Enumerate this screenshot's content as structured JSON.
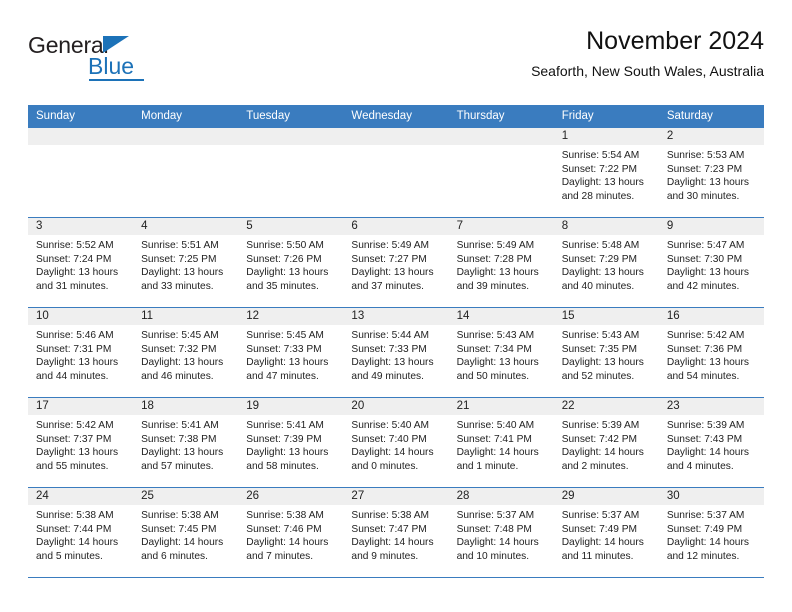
{
  "brand": {
    "name_top": "General",
    "name_bottom": "Blue",
    "accent_color": "#1c72b8"
  },
  "header": {
    "title": "November 2024",
    "subtitle": "Seaforth, New South Wales, Australia"
  },
  "theme": {
    "header_bar_color": "#3a7cbf",
    "daynum_band_color": "#efefef",
    "row_border_color": "#3a7cbf"
  },
  "calendar": {
    "weekday_headers": [
      "Sunday",
      "Monday",
      "Tuesday",
      "Wednesday",
      "Thursday",
      "Friday",
      "Saturday"
    ],
    "weeks": [
      [
        {
          "day": "",
          "empty": true
        },
        {
          "day": "",
          "empty": true
        },
        {
          "day": "",
          "empty": true
        },
        {
          "day": "",
          "empty": true
        },
        {
          "day": "",
          "empty": true
        },
        {
          "day": "1",
          "sunrise": "Sunrise: 5:54 AM",
          "sunset": "Sunset: 7:22 PM",
          "daylight": "Daylight: 13 hours and 28 minutes."
        },
        {
          "day": "2",
          "sunrise": "Sunrise: 5:53 AM",
          "sunset": "Sunset: 7:23 PM",
          "daylight": "Daylight: 13 hours and 30 minutes."
        }
      ],
      [
        {
          "day": "3",
          "sunrise": "Sunrise: 5:52 AM",
          "sunset": "Sunset: 7:24 PM",
          "daylight": "Daylight: 13 hours and 31 minutes."
        },
        {
          "day": "4",
          "sunrise": "Sunrise: 5:51 AM",
          "sunset": "Sunset: 7:25 PM",
          "daylight": "Daylight: 13 hours and 33 minutes."
        },
        {
          "day": "5",
          "sunrise": "Sunrise: 5:50 AM",
          "sunset": "Sunset: 7:26 PM",
          "daylight": "Daylight: 13 hours and 35 minutes."
        },
        {
          "day": "6",
          "sunrise": "Sunrise: 5:49 AM",
          "sunset": "Sunset: 7:27 PM",
          "daylight": "Daylight: 13 hours and 37 minutes."
        },
        {
          "day": "7",
          "sunrise": "Sunrise: 5:49 AM",
          "sunset": "Sunset: 7:28 PM",
          "daylight": "Daylight: 13 hours and 39 minutes."
        },
        {
          "day": "8",
          "sunrise": "Sunrise: 5:48 AM",
          "sunset": "Sunset: 7:29 PM",
          "daylight": "Daylight: 13 hours and 40 minutes."
        },
        {
          "day": "9",
          "sunrise": "Sunrise: 5:47 AM",
          "sunset": "Sunset: 7:30 PM",
          "daylight": "Daylight: 13 hours and 42 minutes."
        }
      ],
      [
        {
          "day": "10",
          "sunrise": "Sunrise: 5:46 AM",
          "sunset": "Sunset: 7:31 PM",
          "daylight": "Daylight: 13 hours and 44 minutes."
        },
        {
          "day": "11",
          "sunrise": "Sunrise: 5:45 AM",
          "sunset": "Sunset: 7:32 PM",
          "daylight": "Daylight: 13 hours and 46 minutes."
        },
        {
          "day": "12",
          "sunrise": "Sunrise: 5:45 AM",
          "sunset": "Sunset: 7:33 PM",
          "daylight": "Daylight: 13 hours and 47 minutes."
        },
        {
          "day": "13",
          "sunrise": "Sunrise: 5:44 AM",
          "sunset": "Sunset: 7:33 PM",
          "daylight": "Daylight: 13 hours and 49 minutes."
        },
        {
          "day": "14",
          "sunrise": "Sunrise: 5:43 AM",
          "sunset": "Sunset: 7:34 PM",
          "daylight": "Daylight: 13 hours and 50 minutes."
        },
        {
          "day": "15",
          "sunrise": "Sunrise: 5:43 AM",
          "sunset": "Sunset: 7:35 PM",
          "daylight": "Daylight: 13 hours and 52 minutes."
        },
        {
          "day": "16",
          "sunrise": "Sunrise: 5:42 AM",
          "sunset": "Sunset: 7:36 PM",
          "daylight": "Daylight: 13 hours and 54 minutes."
        }
      ],
      [
        {
          "day": "17",
          "sunrise": "Sunrise: 5:42 AM",
          "sunset": "Sunset: 7:37 PM",
          "daylight": "Daylight: 13 hours and 55 minutes."
        },
        {
          "day": "18",
          "sunrise": "Sunrise: 5:41 AM",
          "sunset": "Sunset: 7:38 PM",
          "daylight": "Daylight: 13 hours and 57 minutes."
        },
        {
          "day": "19",
          "sunrise": "Sunrise: 5:41 AM",
          "sunset": "Sunset: 7:39 PM",
          "daylight": "Daylight: 13 hours and 58 minutes."
        },
        {
          "day": "20",
          "sunrise": "Sunrise: 5:40 AM",
          "sunset": "Sunset: 7:40 PM",
          "daylight": "Daylight: 14 hours and 0 minutes."
        },
        {
          "day": "21",
          "sunrise": "Sunrise: 5:40 AM",
          "sunset": "Sunset: 7:41 PM",
          "daylight": "Daylight: 14 hours and 1 minute."
        },
        {
          "day": "22",
          "sunrise": "Sunrise: 5:39 AM",
          "sunset": "Sunset: 7:42 PM",
          "daylight": "Daylight: 14 hours and 2 minutes."
        },
        {
          "day": "23",
          "sunrise": "Sunrise: 5:39 AM",
          "sunset": "Sunset: 7:43 PM",
          "daylight": "Daylight: 14 hours and 4 minutes."
        }
      ],
      [
        {
          "day": "24",
          "sunrise": "Sunrise: 5:38 AM",
          "sunset": "Sunset: 7:44 PM",
          "daylight": "Daylight: 14 hours and 5 minutes."
        },
        {
          "day": "25",
          "sunrise": "Sunrise: 5:38 AM",
          "sunset": "Sunset: 7:45 PM",
          "daylight": "Daylight: 14 hours and 6 minutes."
        },
        {
          "day": "26",
          "sunrise": "Sunrise: 5:38 AM",
          "sunset": "Sunset: 7:46 PM",
          "daylight": "Daylight: 14 hours and 7 minutes."
        },
        {
          "day": "27",
          "sunrise": "Sunrise: 5:38 AM",
          "sunset": "Sunset: 7:47 PM",
          "daylight": "Daylight: 14 hours and 9 minutes."
        },
        {
          "day": "28",
          "sunrise": "Sunrise: 5:37 AM",
          "sunset": "Sunset: 7:48 PM",
          "daylight": "Daylight: 14 hours and 10 minutes."
        },
        {
          "day": "29",
          "sunrise": "Sunrise: 5:37 AM",
          "sunset": "Sunset: 7:49 PM",
          "daylight": "Daylight: 14 hours and 11 minutes."
        },
        {
          "day": "30",
          "sunrise": "Sunrise: 5:37 AM",
          "sunset": "Sunset: 7:49 PM",
          "daylight": "Daylight: 14 hours and 12 minutes."
        }
      ]
    ]
  }
}
